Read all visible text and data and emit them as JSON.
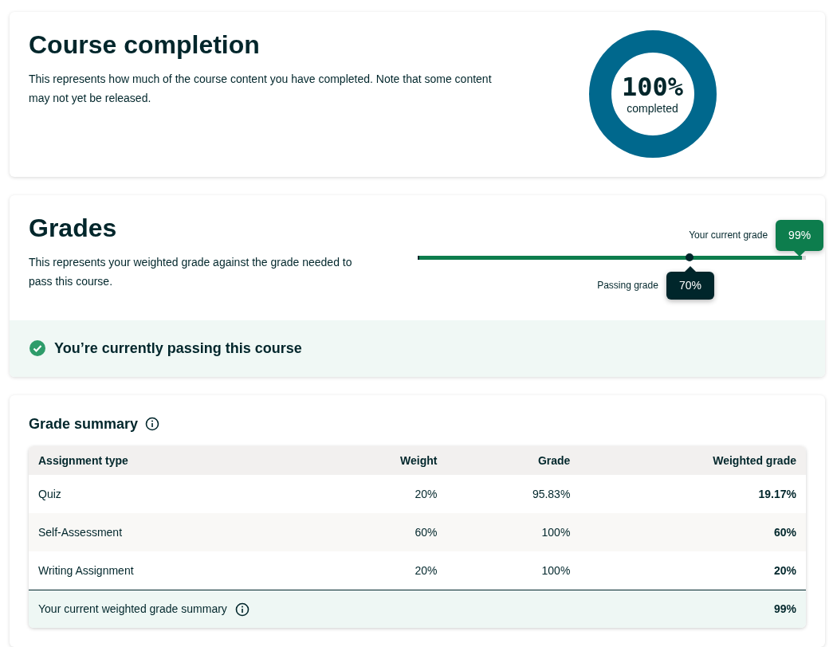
{
  "completion": {
    "title": "Course completion",
    "description": "This represents how much of the course content you have completed. Note that some content may not yet be released.",
    "percent": "100%",
    "caption": "completed",
    "level": 1
  },
  "grades": {
    "title": "Grades",
    "description": "This represents your weighted grade against the grade needed to pass this course.",
    "current": {
      "label": "Your current grade",
      "value": "99%",
      "level": 0.99
    },
    "passing": {
      "label": "Passing grade",
      "value": "70%",
      "level": 0.7
    },
    "status": {
      "passing": true,
      "message": "You’re currently passing this course"
    }
  },
  "summary": {
    "title": "Grade summary",
    "columns": [
      "Assignment type",
      "Weight",
      "Grade",
      "Weighted grade"
    ],
    "rows": [
      {
        "type": "Quiz",
        "weight": "20%",
        "grade": "95.83%",
        "weighted": "19.17%"
      },
      {
        "type": "Self-Assessment",
        "weight": "60%",
        "grade": "100%",
        "weighted": "60%"
      },
      {
        "type": "Writing Assignment",
        "weight": "20%",
        "grade": "100%",
        "weighted": "20%"
      }
    ],
    "footer": {
      "label": "Your current weighted grade summary",
      "value": "99%"
    }
  }
}
